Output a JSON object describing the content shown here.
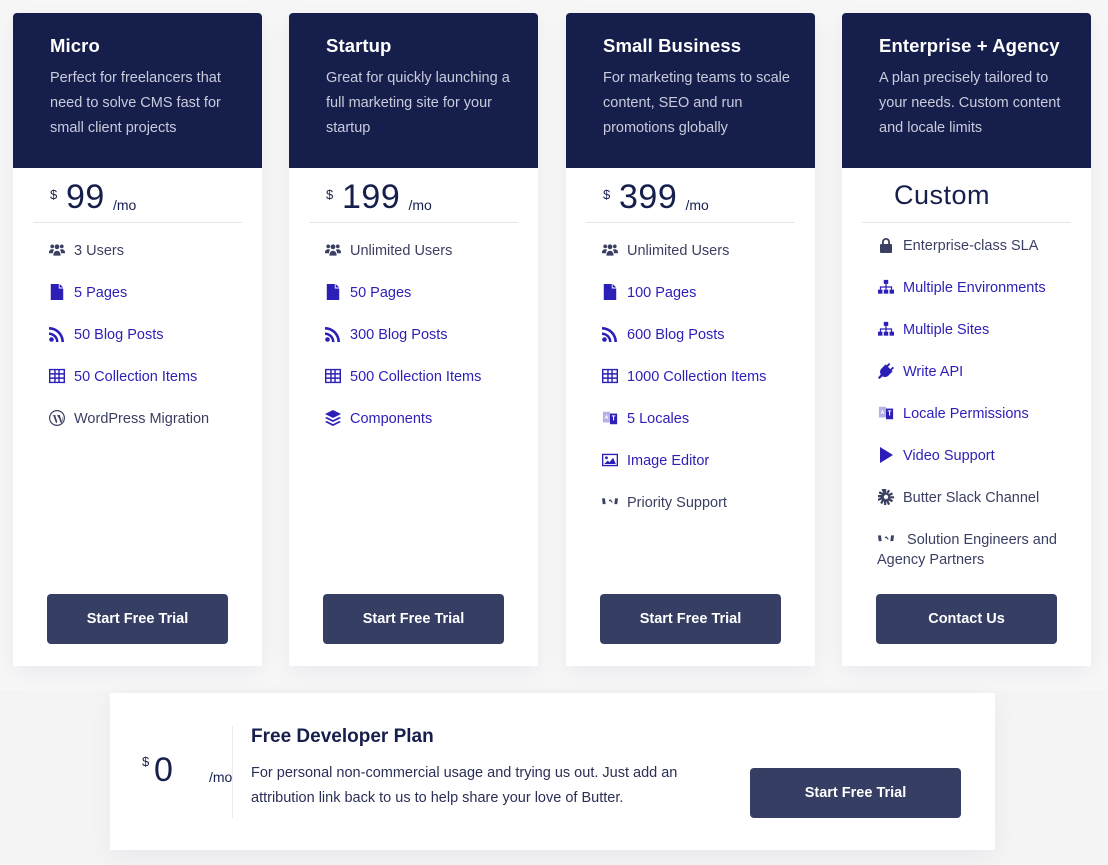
{
  "plans": [
    {
      "name": "Micro",
      "description": "Perfect for freelancers that need to solve CMS fast for small client projects",
      "currency": "$",
      "price": "99",
      "period": "/mo",
      "features": [
        {
          "icon": "users-icon",
          "label": "3 Users",
          "style": "dark"
        },
        {
          "icon": "file-icon",
          "label": "5 Pages",
          "style": "blue"
        },
        {
          "icon": "rss-icon",
          "label": "50 Blog Posts",
          "style": "blue"
        },
        {
          "icon": "table-icon",
          "label": "50 Collection Items",
          "style": "blue"
        },
        {
          "icon": "wordpress-icon",
          "label": "WordPress Migration",
          "style": "dark"
        }
      ],
      "cta": "Start Free Trial"
    },
    {
      "name": "Startup",
      "description": "Great for quickly launching a full marketing site for your startup",
      "currency": "$",
      "price": "199",
      "period": "/mo",
      "features": [
        {
          "icon": "users-icon",
          "label": "Unlimited Users",
          "style": "dark"
        },
        {
          "icon": "file-icon",
          "label": "50 Pages",
          "style": "blue"
        },
        {
          "icon": "rss-icon",
          "label": "300 Blog Posts",
          "style": "blue"
        },
        {
          "icon": "table-icon",
          "label": "500 Collection Items",
          "style": "blue"
        },
        {
          "icon": "layers-icon",
          "label": "Components",
          "style": "blue"
        }
      ],
      "cta": "Start Free Trial"
    },
    {
      "name": "Small Business",
      "description": "For marketing teams to scale content, SEO and run promotions globally",
      "currency": "$",
      "price": "399",
      "period": "/mo",
      "features": [
        {
          "icon": "users-icon",
          "label": "Unlimited Users",
          "style": "dark"
        },
        {
          "icon": "file-icon",
          "label": "100 Pages",
          "style": "blue"
        },
        {
          "icon": "rss-icon",
          "label": "600 Blog Posts",
          "style": "blue"
        },
        {
          "icon": "table-icon",
          "label": "1000 Collection Items",
          "style": "blue"
        },
        {
          "icon": "language-icon",
          "label": "5 Locales",
          "style": "blue"
        },
        {
          "icon": "image-icon",
          "label": "Image Editor",
          "style": "blue"
        },
        {
          "icon": "handshake-icon",
          "label": "Priority Support",
          "style": "dark"
        }
      ],
      "cta": "Start Free Trial"
    },
    {
      "name": "Enterprise + Agency",
      "description": "A plan precisely tailored to your needs. Custom content and locale limits",
      "price_custom": "Custom",
      "features": [
        {
          "icon": "lock-icon",
          "label": "Enterprise-class SLA",
          "style": "dark"
        },
        {
          "icon": "sitemap-icon",
          "label": "Multiple Environments",
          "style": "blue"
        },
        {
          "icon": "sitemap-icon",
          "label": "Multiple Sites",
          "style": "blue"
        },
        {
          "icon": "plug-icon",
          "label": "Write API",
          "style": "blue"
        },
        {
          "icon": "language-icon",
          "label": "Locale Permissions",
          "style": "blue"
        },
        {
          "icon": "play-icon",
          "label": "Video Support",
          "style": "blue"
        },
        {
          "icon": "slack-icon",
          "label": "Butter Slack Channel",
          "style": "dark"
        },
        {
          "icon": "handshake-icon",
          "label": "Solution Engineers and Agency Partners",
          "style": "dark"
        }
      ],
      "cta": "Contact Us"
    }
  ],
  "free_plan": {
    "currency": "$",
    "price": "0",
    "period": "/mo",
    "title": "Free Developer Plan",
    "description": "For personal non-commercial usage and trying us out. Just add an attribution link back to us to help share your love of Butter.",
    "cta": "Start Free Trial"
  },
  "colors": {
    "header_bg": "#161f4c",
    "button_bg": "#363e63",
    "link_blue": "#2c1fb8",
    "text_dark": "#3b4062"
  }
}
